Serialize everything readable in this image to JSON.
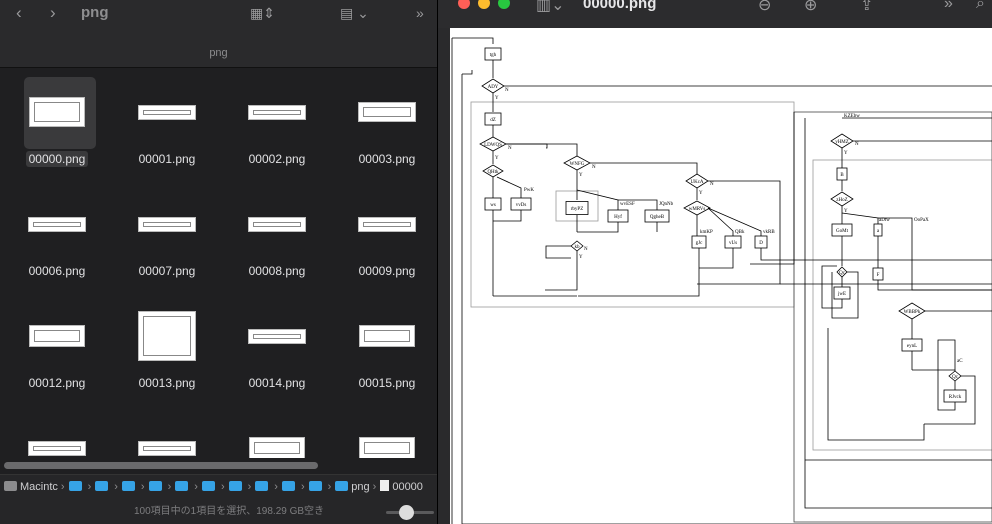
{
  "finder": {
    "window_title": "png",
    "path_title": "png",
    "nav_back_icon": "chevron-left-icon",
    "nav_forward_icon": "chevron-right-icon",
    "view_icon": "grid-view-icon",
    "group_icon": "group-icon",
    "more_icon": "double-chevron-right-icon",
    "files": [
      {
        "name": "00000.png",
        "selected": true,
        "thumb": "small-diagram"
      },
      {
        "name": "00001.png",
        "thumb": "wide"
      },
      {
        "name": "00002.png",
        "thumb": "wide"
      },
      {
        "name": "00003.png",
        "thumb": "wide-diagram"
      },
      {
        "name": "00006.png",
        "thumb": "wide"
      },
      {
        "name": "00007.png",
        "thumb": "wide"
      },
      {
        "name": "00008.png",
        "thumb": "wide"
      },
      {
        "name": "00009.png",
        "thumb": "wide"
      },
      {
        "name": "00012.png",
        "thumb": "mid-diagram"
      },
      {
        "name": "00013.png",
        "thumb": "square-diagram"
      },
      {
        "name": "00014.png",
        "thumb": "wide"
      },
      {
        "name": "00015.png",
        "thumb": "mid-diagram"
      },
      {
        "name": "",
        "thumb": "wide"
      },
      {
        "name": "",
        "thumb": "wide"
      },
      {
        "name": "",
        "thumb": "mid-diagram"
      },
      {
        "name": "",
        "thumb": "mid-diagram"
      }
    ],
    "breadcrumbs": {
      "drive": "Macintc",
      "folder_count": 10,
      "last_folder": "png",
      "file": "00000"
    },
    "status_text": "100項目中の1項目を選択、198.29 GB空き"
  },
  "preview": {
    "title": "00000.png",
    "zoom_out_icon": "zoom-out-icon",
    "zoom_in_icon": "zoom-in-icon",
    "share_icon": "share-icon",
    "sidebar_icon": "sidebar-icon",
    "colors": {
      "close": "#ff5f57",
      "minimize": "#febc2e",
      "zoom": "#28c840"
    },
    "diagram_labels": {
      "n1": "tgh",
      "n2": "ADY",
      "n3": "dZ",
      "n4": "LDWQS",
      "n5": "QHtk",
      "n6": "ws",
      "n7": "vvDs",
      "n8": "WNFG",
      "n9": "rbyPZ",
      "n10": "Hyf",
      "n11": "QgheB",
      "n12": "kb",
      "n13": "UKcA",
      "n14": "wMRVs",
      "n15": "gJc",
      "n16": "vUs",
      "n17": "D",
      "n18": "yHMZ",
      "n19": "B",
      "n20": "zHoZ",
      "n21": "GoMt",
      "n22": "a",
      "n23": "F",
      "n24": "jwE",
      "n25": "WBBPk",
      "n26": "eynL",
      "n27": "Qc",
      "n28": "RJvck",
      "e_n": "N",
      "e_y": "Y",
      "e_pwk": "PwK",
      "e_wkf": "wvESF",
      "e_jqnb": "JQnNb",
      "e_kmp": "kmKP",
      "e_qbt": "QBk",
      "e_rkb": "vkRB",
      "e_ktw": "KZEbw",
      "e_atw": "aDtw",
      "e_ofax": "OoPaX",
      "e_ac": "aC"
    }
  }
}
